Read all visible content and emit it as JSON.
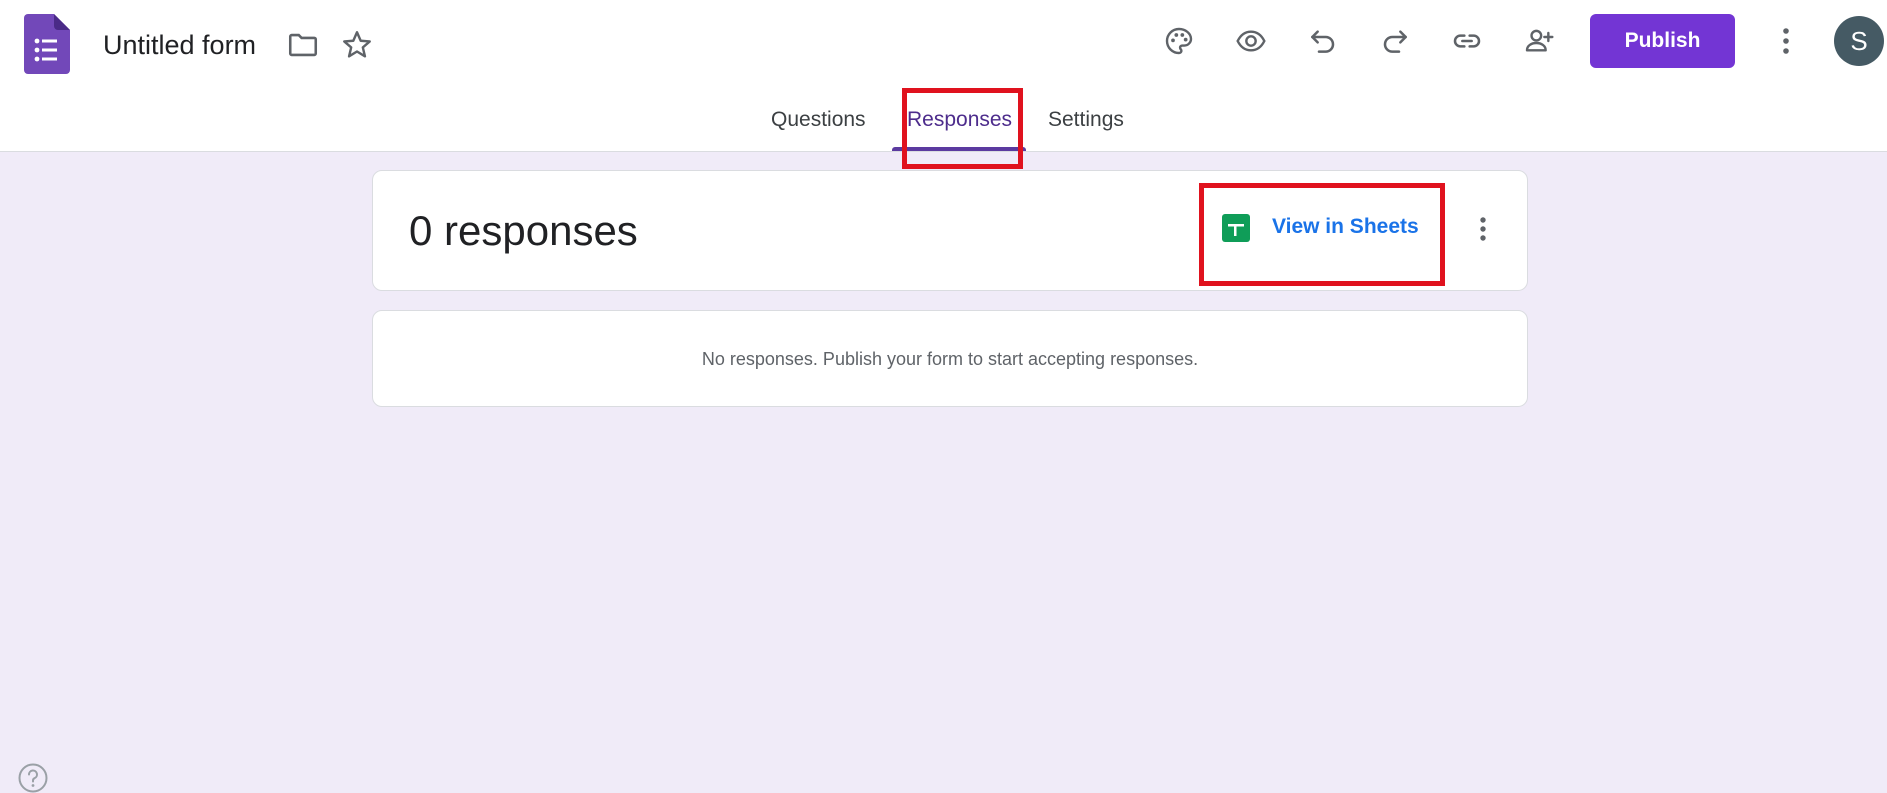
{
  "header": {
    "title": "Untitled form",
    "publish_label": "Publish",
    "avatar_initial": "S",
    "icons": [
      "forms-logo-icon",
      "folder-icon",
      "star-icon",
      "palette-icon",
      "preview-eye-icon",
      "undo-icon",
      "redo-icon",
      "link-icon",
      "add-collaborator-icon",
      "more-vert-icon"
    ]
  },
  "tabs": [
    {
      "label": "Questions",
      "active": false
    },
    {
      "label": "Responses",
      "active": true
    },
    {
      "label": "Settings",
      "active": false
    }
  ],
  "responses_card": {
    "count_text": "0 responses",
    "sheets_link": "View in Sheets"
  },
  "empty_card": {
    "message": "No responses. Publish your form to start accepting responses."
  },
  "colors": {
    "accent": "#7335d4",
    "background": "#f0ebf8",
    "link": "#1a73e8",
    "highlight": "#e0121e",
    "sheets_green": "#0f9d58"
  }
}
